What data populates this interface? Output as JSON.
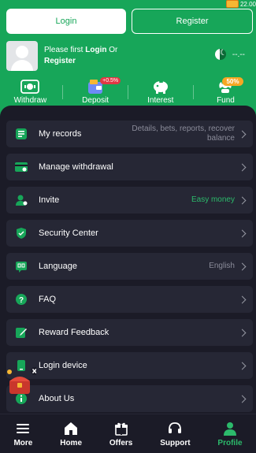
{
  "header": {
    "login_label": "Login",
    "register_label": "Register",
    "promo_text": "22.00",
    "user": {
      "prefix": "Please first ",
      "login": "Login",
      "or": " Or",
      "register": "Register"
    },
    "balance": "--.--",
    "actions": [
      {
        "label": "Withdraw"
      },
      {
        "label": "Deposit",
        "badge": "+0.5%"
      },
      {
        "label": "Interest"
      },
      {
        "label": "Fund",
        "badge": "50%"
      }
    ]
  },
  "menu": [
    {
      "label": "My records",
      "value": "Details, bets, reports, recover balance"
    },
    {
      "label": "Manage withdrawal",
      "value": ""
    },
    {
      "label": "Invite",
      "value": "Easy money"
    },
    {
      "label": "Security Center",
      "value": ""
    },
    {
      "label": "Language",
      "value": "English"
    },
    {
      "label": "FAQ",
      "value": ""
    },
    {
      "label": "Reward Feedback",
      "value": ""
    },
    {
      "label": "Login device",
      "value": ""
    },
    {
      "label": "About Us",
      "value": ""
    }
  ],
  "nav": [
    {
      "label": "More"
    },
    {
      "label": "Home"
    },
    {
      "label": "Offers"
    },
    {
      "label": "Support"
    },
    {
      "label": "Profile"
    }
  ],
  "colors": {
    "accent": "#17a659",
    "bg": "#1b1b27",
    "row": "#262735"
  }
}
